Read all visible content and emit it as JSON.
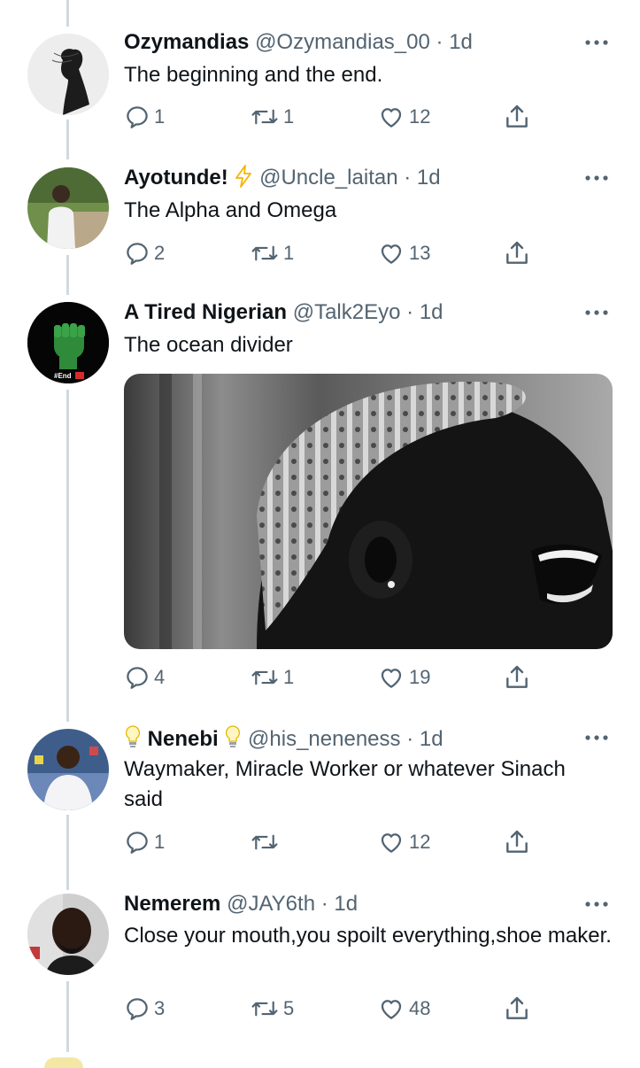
{
  "tweets": [
    {
      "name": "Ozymandias",
      "handle": "@Ozymandias_00",
      "time": "1d",
      "text": "The beginning and the end.",
      "replies": "1",
      "retweets": "1",
      "likes": "12"
    },
    {
      "name": "Ayotunde!",
      "handle": "@Uncle_laitan",
      "time": "1d",
      "text": "The Alpha and Omega",
      "replies": "2",
      "retweets": "1",
      "likes": "13",
      "name_emoji": "lightning-icon"
    },
    {
      "name": "A Tired Nigerian",
      "handle": "@Talk2Eyo",
      "time": "1d",
      "text": "The ocean divider",
      "replies": "4",
      "retweets": "1",
      "likes": "19",
      "avatar_caption": "#End"
    },
    {
      "name": "Nenebi",
      "handle": "@his_neneness",
      "time": "1d",
      "text": "Waymaker, Miracle Worker or whatever Sinach said",
      "replies": "1",
      "retweets": "",
      "likes": "12",
      "name_emoji": "lightbulb-icon"
    },
    {
      "name": "Nemerem",
      "handle": "@JAY6th",
      "time": "1d",
      "text": "Close your mouth,you spoilt everything,shoe maker.",
      "replies": "3",
      "retweets": "5",
      "likes": "48"
    }
  ],
  "separator": "·",
  "colors": {
    "muted": "#536471",
    "thread_line": "#cfd9de",
    "lightning": "#f4b400",
    "bulb": "#f5d76e"
  }
}
